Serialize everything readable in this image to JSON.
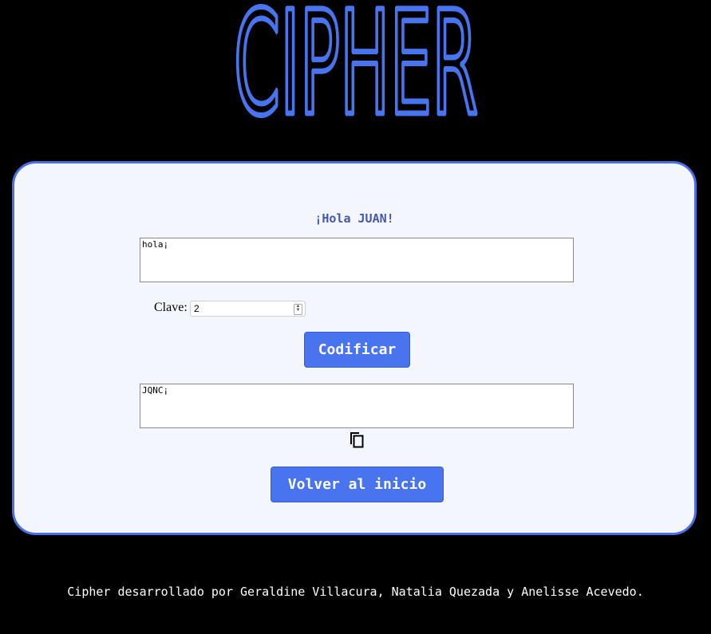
{
  "header": {
    "logo_text": "CIPHER"
  },
  "card": {
    "greeting": "¡Hola JUAN!",
    "input_text": "hola¡",
    "clave_label": "Clave:",
    "clave_value": "2",
    "encode_button": "Codificar",
    "output_text": "JQNC¡",
    "copy_icon": "copy-icon",
    "back_button": "Volver al inicio"
  },
  "footer": {
    "credits": "Cipher desarrollado por Geraldine Villacura, Natalia Quezada y Anelisse Acevedo."
  },
  "colors": {
    "accent": "#4874f0",
    "card_bg": "#f4f6fd",
    "card_border": "#4a6fe6",
    "greeting": "#4558b0"
  }
}
